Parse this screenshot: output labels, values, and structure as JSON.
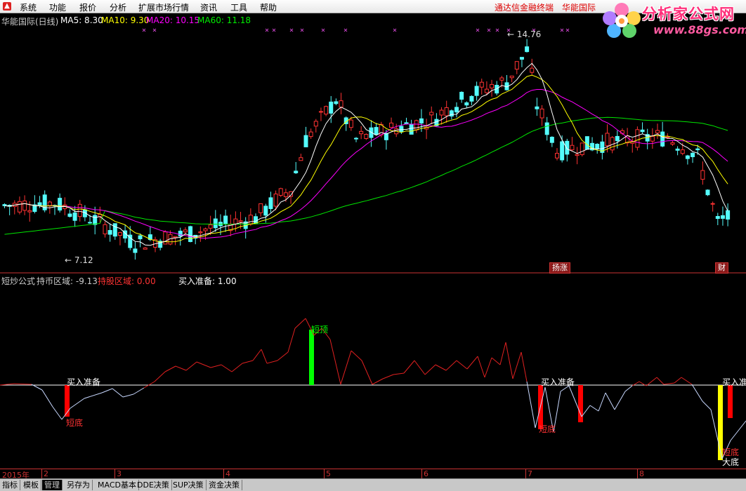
{
  "menu": {
    "items": [
      "系统",
      "功能",
      "报价",
      "分析",
      "扩展市场行情",
      "资讯",
      "工具",
      "帮助"
    ],
    "right_items": [
      "通达信金融终端",
      "华能国际"
    ]
  },
  "logo": {
    "title": "分析家公式网",
    "url": "www.88gs.com"
  },
  "main_legend": {
    "stock": "华能国际(日线)",
    "ma5": "MA5: 8.30",
    "ma10": "MA10: 9.30",
    "ma20": "MA20: 10.15",
    "ma60": "MA60: 11.18"
  },
  "colors": {
    "up": "#ff3232",
    "down": "#54fcfc",
    "ma5": "#ffffff",
    "ma10": "#ffff00",
    "ma20": "#ff00ff",
    "ma60": "#00e600",
    "signal_red": "#ff0000",
    "signal_green": "#00ff00",
    "signal_yellow": "#ffff00"
  },
  "price_labels": {
    "high": "14.76",
    "low": "7.12"
  },
  "event_badges": [
    "扬涨",
    "财"
  ],
  "indicator": {
    "name": "短炒公式",
    "hold_coin": "持币区域: -9.13",
    "hold_stock": "持股区域: 0.00",
    "buy_ready": "买入准备: 1.00",
    "annotations": {
      "buy_ready_1": "买入准备",
      "short_bottom_1": "短底",
      "short_top": "短顶",
      "buy_ready_2": "买入准备",
      "short_bottom_2": "短底",
      "buy_ready_3": "买入准",
      "short_bottom_3": "短底",
      "big_bottom": "大底"
    }
  },
  "time_axis": {
    "year": "2015年",
    "months": [
      "2",
      "3",
      "4",
      "5",
      "6",
      "7",
      "8"
    ]
  },
  "tabs": [
    "指标",
    "模板",
    "管理",
    "另存为",
    "MACD基本",
    "DDE决策",
    "SUP决策",
    "资金决策"
  ]
}
